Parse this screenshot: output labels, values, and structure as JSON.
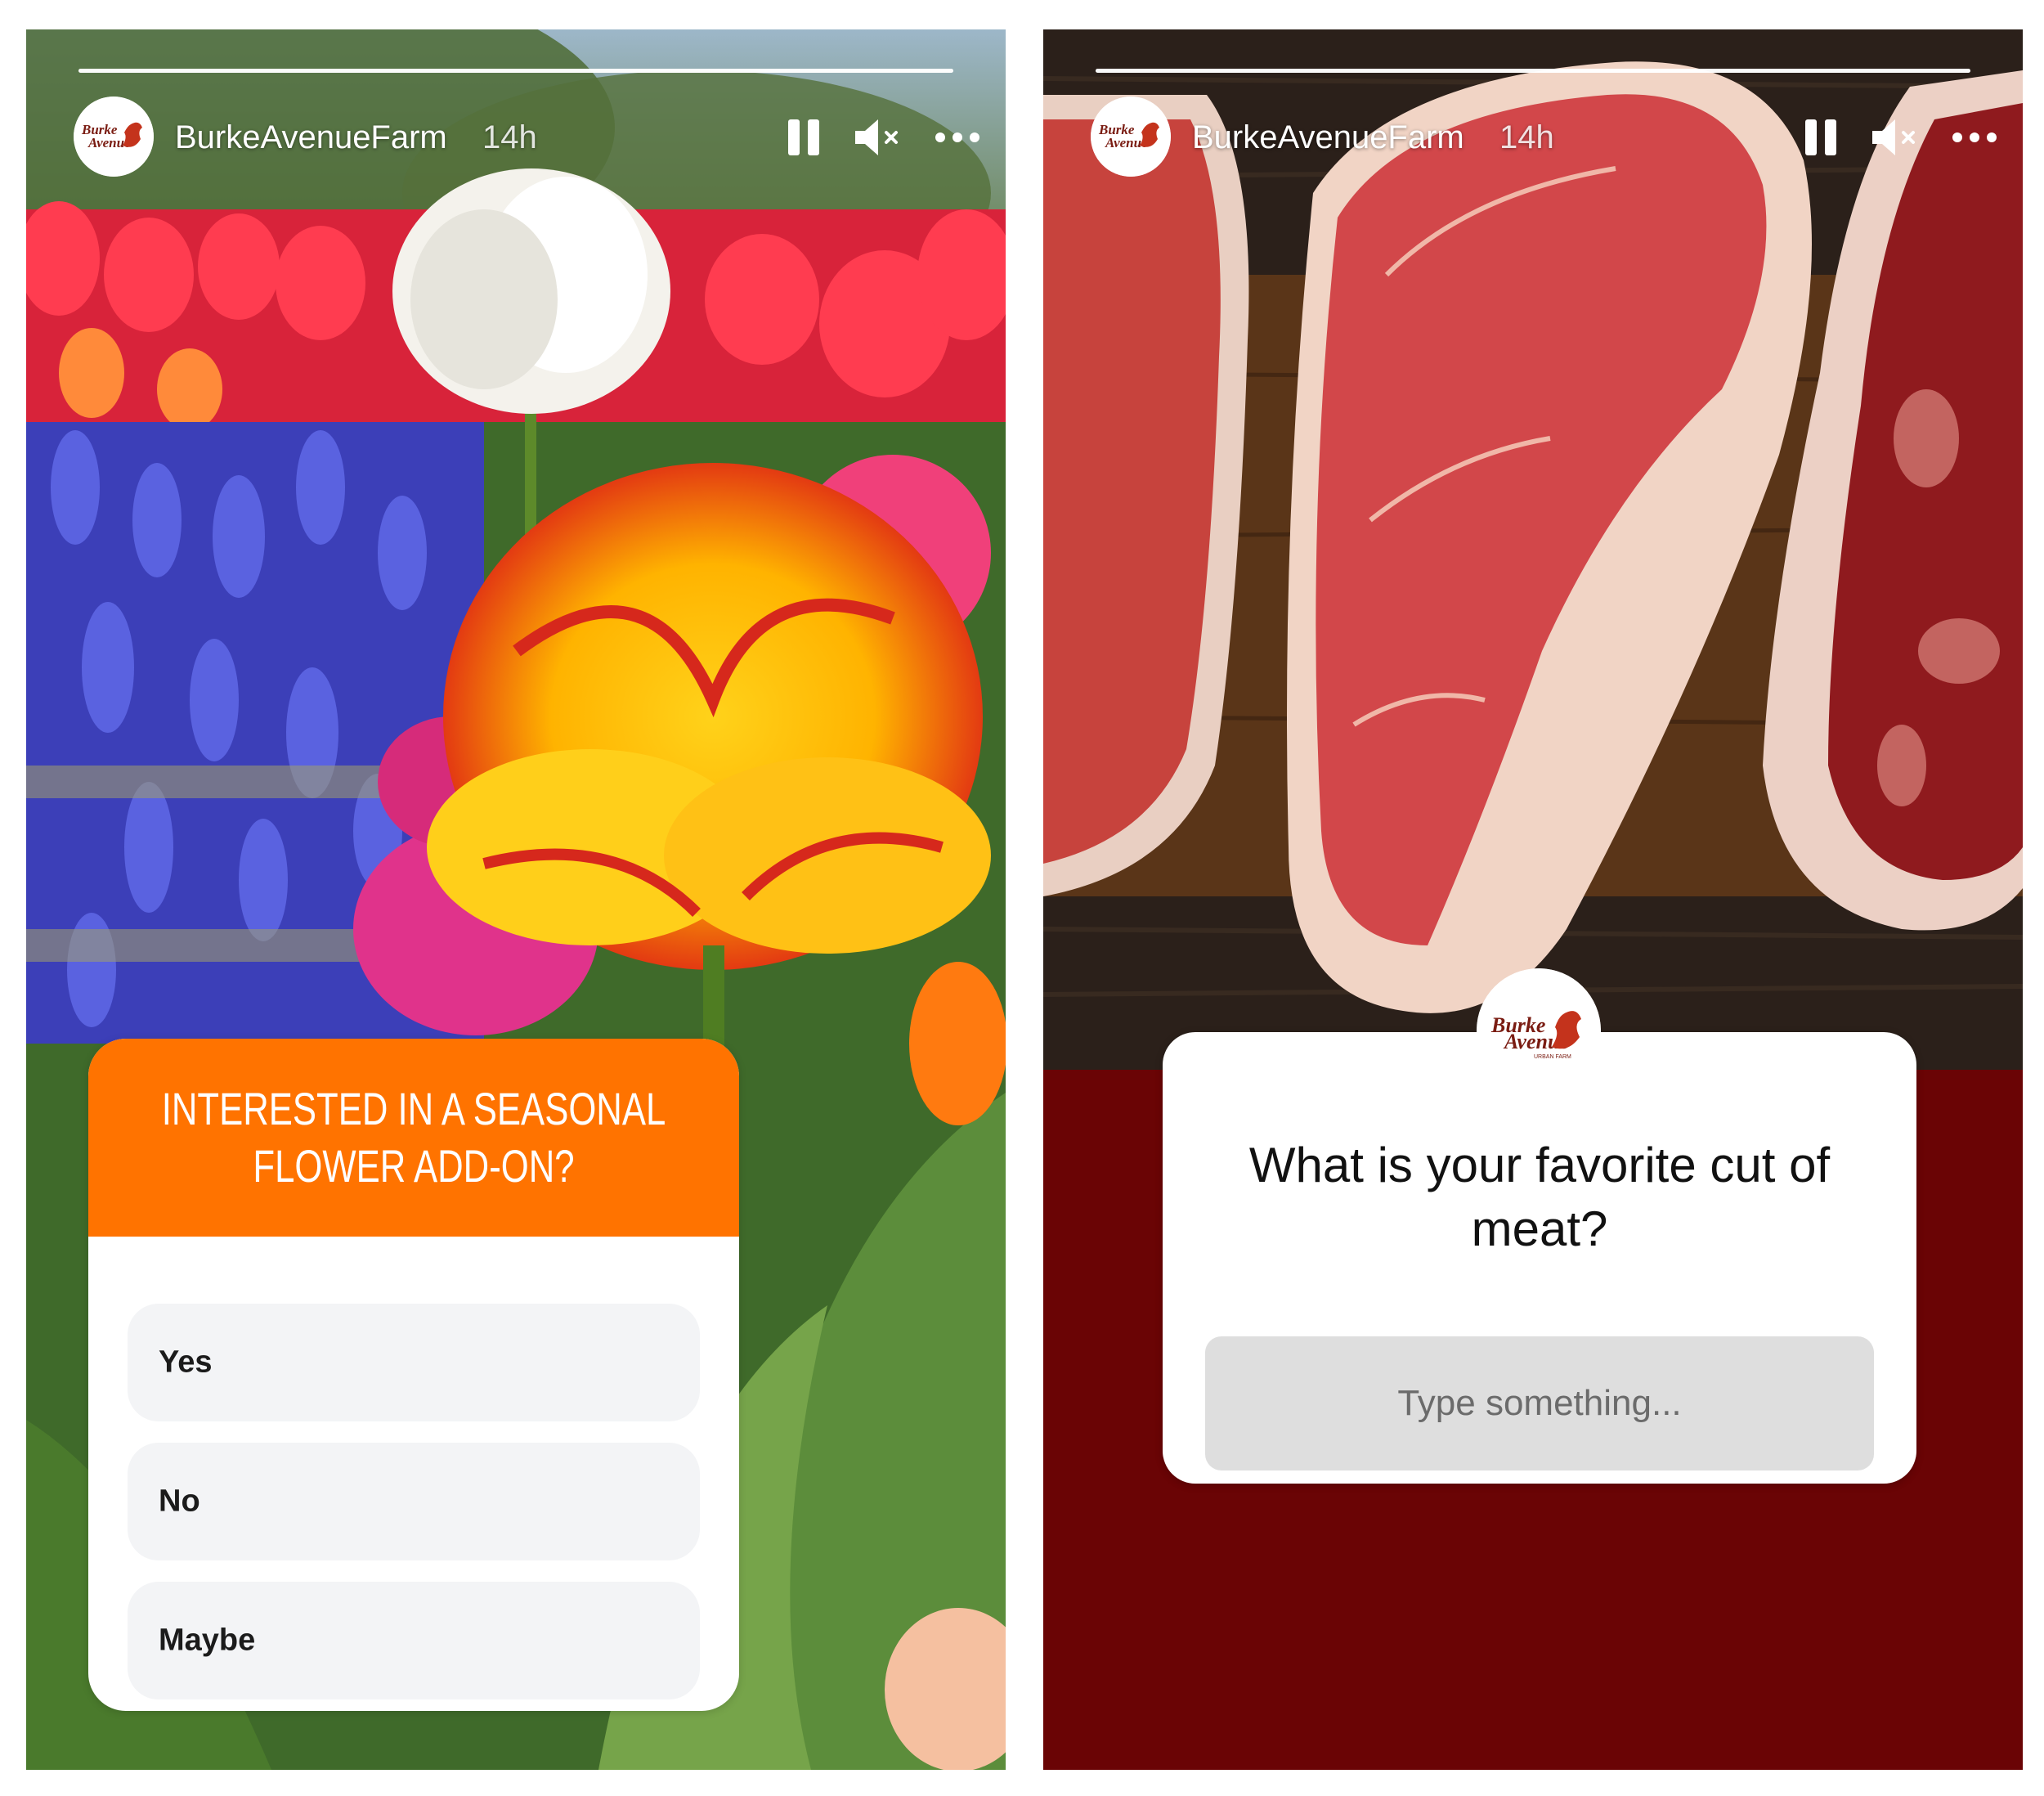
{
  "stories": [
    {
      "account": {
        "username": "BurkeAvenueFarm",
        "time": "14h",
        "logo_text_1": "Burke",
        "logo_text_2": "Avenue"
      },
      "progress": 1.0,
      "controls": {
        "pause_icon": "pause-icon",
        "mute_icon": "volume-muted-icon",
        "more_icon": "more-horizontal-icon"
      },
      "background": "tulip-garden-photo",
      "poll": {
        "question": "INTERESTED IN A SEASONAL FLOWER ADD-ON?",
        "options": [
          "Yes",
          "No",
          "Maybe"
        ],
        "header_color": "#ff7300"
      }
    },
    {
      "account": {
        "username": "BurkeAvenueFarm",
        "time": "14h",
        "logo_text_1": "Burke",
        "logo_text_2": "Avenue",
        "logo_subtext": "URBAN FARM"
      },
      "progress": 1.0,
      "controls": {
        "pause_icon": "pause-icon",
        "mute_icon": "volume-muted-icon",
        "more_icon": "more-horizontal-icon"
      },
      "background": "raw-steaks-photo",
      "question_box": {
        "question": "What is your favorite cut of meat?",
        "placeholder": "Type something...",
        "background_color": "#6a0405"
      }
    }
  ]
}
